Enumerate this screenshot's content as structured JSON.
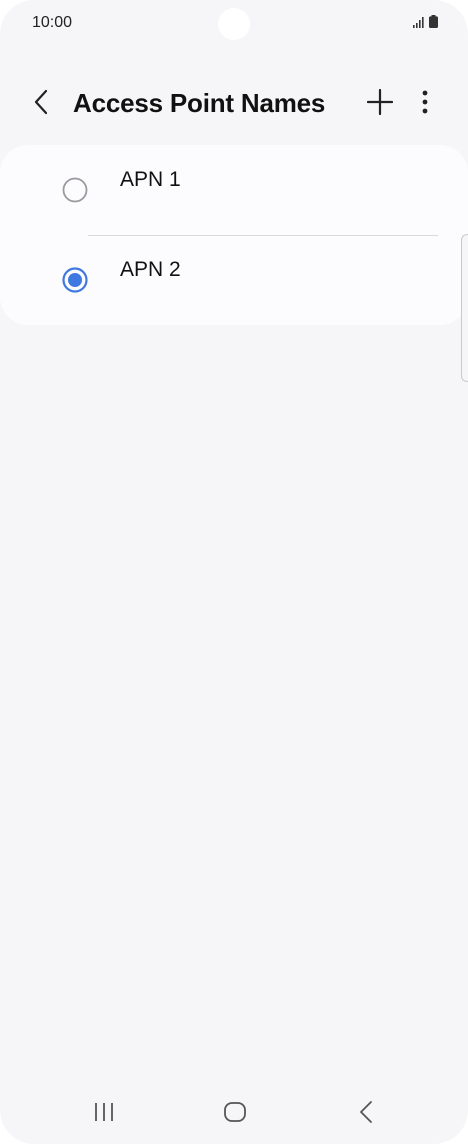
{
  "status_bar": {
    "time": "10:00",
    "icons": [
      "signal-icon",
      "battery-icon"
    ]
  },
  "app_bar": {
    "title": "Access Point Names",
    "back_icon": "back-chevron-icon",
    "add_icon": "plus-icon",
    "more_icon": "more-vertical-icon"
  },
  "apn_list": {
    "items": [
      {
        "label": "APN 1",
        "selected": false
      },
      {
        "label": "APN 2",
        "selected": true
      }
    ]
  },
  "nav_bar": {
    "icons": [
      "recents-icon",
      "home-icon",
      "back-icon"
    ]
  },
  "colors": {
    "accent": "#3e78e0",
    "background": "#f6f6f8",
    "card": "#fcfcfe"
  }
}
